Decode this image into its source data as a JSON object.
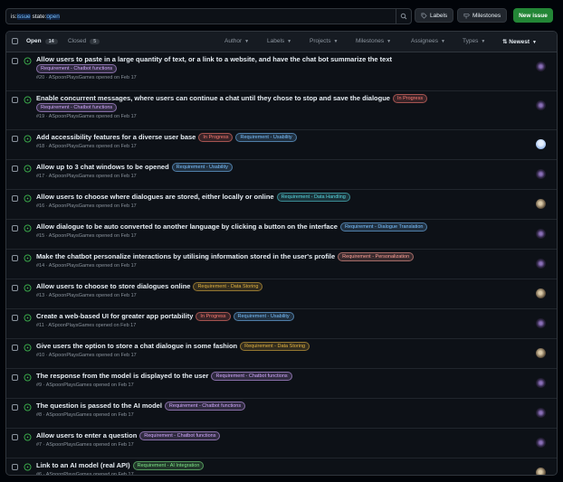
{
  "search": {
    "prefix": "is:",
    "kw1": "issue",
    "mid": " state:",
    "kw2": "open"
  },
  "toolbar": {
    "labels": "Labels",
    "milestones": "Milestones",
    "new_issue": "New issue"
  },
  "tabs": {
    "open_label": "Open",
    "open_count": "14",
    "closed_label": "Closed",
    "closed_count": "5"
  },
  "filters": {
    "author": "Author",
    "labels": "Labels",
    "projects": "Projects",
    "milestones": "Milestones",
    "assignees": "Assignees",
    "types": "Types",
    "newest": "Newest"
  },
  "colors": {
    "purple": "#d2a8ff",
    "red": "#ff7b72",
    "blue": "#79c0ff",
    "teal": "#56d4dd",
    "orange": "#ffa198",
    "yellow": "#e3b341",
    "green": "#7ee787",
    "open_icon": "#3fb950"
  },
  "issues": [
    {
      "title": "Allow users to paste in a large quantity of text, or a link to a website, and have the chat bot summarize the text",
      "labels": [
        {
          "text": "Requirement - Chatbot functions",
          "color": "purple"
        }
      ],
      "label_newline": true,
      "meta": "#20 · ASpoonPlaysGames opened on Feb 17",
      "avatar": "dark"
    },
    {
      "title": "Enable concurrent messages, where users can continue a chat until they chose to stop and save the dialogue",
      "labels": [
        {
          "text": "In Progress",
          "color": "red"
        },
        {
          "text": "Requirement - Chatbot functions",
          "color": "purple",
          "newline": true
        }
      ],
      "meta": "#19 · ASpoonPlaysGames opened on Feb 17",
      "avatar": "dark"
    },
    {
      "title": "Add accessibility features for a diverse user base",
      "labels": [
        {
          "text": "In Progress",
          "color": "red"
        },
        {
          "text": "Requirement - Usability",
          "color": "blue"
        }
      ],
      "meta": "#18 · ASpoonPlaysGames opened on Feb 17",
      "avatar": "light"
    },
    {
      "title": "Allow up to 3 chat windows to be opened",
      "labels": [
        {
          "text": "Requirement - Usability",
          "color": "blue"
        }
      ],
      "meta": "#17 · ASpoonPlaysGames opened on Feb 17",
      "avatar": "dark"
    },
    {
      "title": "Allow users to choose where dialogues are stored, either locally or online",
      "labels": [
        {
          "text": "Requirement - Data Handling",
          "color": "teal"
        }
      ],
      "meta": "#16 · ASpoonPlaysGames opened on Feb 17",
      "avatar": "photo"
    },
    {
      "title": "Allow dialogue to be auto converted to another language by clicking a button on the interface",
      "labels": [
        {
          "text": "Requirement - Dialogue Translation",
          "color": "blue"
        }
      ],
      "meta": "#15 · ASpoonPlaysGames opened on Feb 17",
      "avatar": "dark"
    },
    {
      "title": "Make the chatbot personalize interactions by utilising information stored in the user's profile",
      "labels": [
        {
          "text": "Requirement - Personalization",
          "color": "orange"
        }
      ],
      "meta": "#14 · ASpoonPlaysGames opened on Feb 17",
      "avatar": "dark"
    },
    {
      "title": "Allow users to choose to store dialogues online",
      "labels": [
        {
          "text": "Requirement - Data Storing",
          "color": "yellow"
        }
      ],
      "meta": "#13 · ASpoonPlaysGames opened on Feb 17",
      "avatar": "photo"
    },
    {
      "title": "Create a web-based UI for greater app portability",
      "labels": [
        {
          "text": "In Progress",
          "color": "red"
        },
        {
          "text": "Requirement - Usability",
          "color": "blue"
        }
      ],
      "meta": "#11 · ASpoonPlaysGames opened on Feb 17",
      "avatar": "dark"
    },
    {
      "title": "Give users the option to store a chat dialogue in some fashion",
      "labels": [
        {
          "text": "Requirement - Data Storing",
          "color": "yellow"
        }
      ],
      "meta": "#10 · ASpoonPlaysGames opened on Feb 17",
      "avatar": "photo"
    },
    {
      "title": "The response from the model is displayed to the user",
      "labels": [
        {
          "text": "Requirement - Chatbot functions",
          "color": "purple"
        }
      ],
      "meta": "#9 · ASpoonPlaysGames opened on Feb 17",
      "avatar": "dark"
    },
    {
      "title": "The question is passed to the AI model",
      "labels": [
        {
          "text": "Requirement - Chatbot functions",
          "color": "purple"
        }
      ],
      "meta": "#8 · ASpoonPlaysGames opened on Feb 17",
      "avatar": "dark"
    },
    {
      "title": "Allow users to enter a question",
      "labels": [
        {
          "text": "Requirement - Chatbot functions",
          "color": "purple"
        }
      ],
      "meta": "#7 · ASpoonPlaysGames opened on Feb 17",
      "avatar": "dark"
    },
    {
      "title": "Link to an AI model (real API)",
      "labels": [
        {
          "text": "Requirement - AI Integration",
          "color": "green"
        }
      ],
      "meta": "#6 · ASpoonPlaysGames opened on Feb 17",
      "avatar": "photo"
    }
  ]
}
